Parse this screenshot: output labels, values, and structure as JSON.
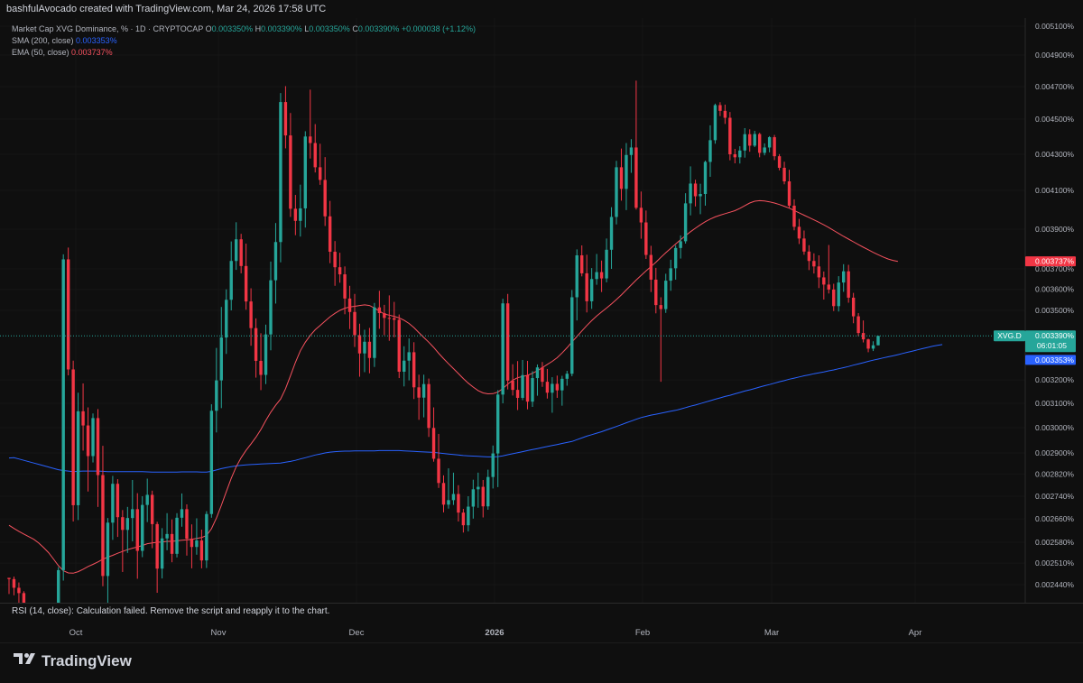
{
  "header": {
    "text": "bashfulAvocado created with TradingView.com, Mar 24, 2026 17:58 UTC"
  },
  "legend": {
    "title": "Market Cap XVG Dominance, % · 1D · CRYPTOCAP",
    "o_label": "O",
    "o_value": "0.003350%",
    "h_label": "H",
    "h_value": "0.003390%",
    "l_label": "L",
    "l_value": "0.003350%",
    "c_label": "C",
    "c_value": "0.003390%",
    "change": "+0.000038 (+1.12%)",
    "sma_label": "SMA (200, close)",
    "sma_value": "0.003353%",
    "ema_label": "EMA (50, close)",
    "ema_value": "0.003737%"
  },
  "rsi": {
    "text": "RSI (14, close): Calculation failed. Remove the script and reapply it to the chart."
  },
  "brand": {
    "name": "TradingView"
  },
  "colors": {
    "up": "#26a69a",
    "down": "#f23645",
    "sma": "#2962ff",
    "ema": "#f7525f",
    "background": "#0f0f0f"
  },
  "chart_data": {
    "type": "candlestick",
    "symbol": "XVG.D",
    "price_axis": {
      "ticks": [
        "0.005100%",
        "0.004900%",
        "0.004700%",
        "0.004500%",
        "0.004300%",
        "0.004100%",
        "0.003900%",
        "0.003700%",
        "0.003600%",
        "0.003500%",
        "0.003200%",
        "0.003100%",
        "0.003000%",
        "0.002900%",
        "0.002820%",
        "0.002740%",
        "0.002660%",
        "0.002580%",
        "0.002510%",
        "0.002440%"
      ],
      "scale": "log"
    },
    "time_axis": {
      "ticks": [
        "Oct",
        "Nov",
        "Dec",
        "2026",
        "Feb",
        "Mar",
        "Apr"
      ]
    },
    "labels": {
      "ema_price": "0.003737%",
      "last_symbol": "XVG.D",
      "last_price": "0.003390%",
      "countdown": "06:01:05",
      "sma_price": "0.003353%"
    },
    "candles": [
      [
        2.462,
        2.462,
        2.41,
        2.458
      ],
      [
        2.458,
        2.466,
        2.406,
        2.43
      ],
      [
        2.43,
        2.447,
        2.357,
        2.413
      ],
      [
        2.413,
        2.419,
        2.213,
        2.327
      ],
      [
        2.327,
        2.359,
        2.178,
        2.231
      ],
      [
        2.231,
        2.343,
        2.213,
        2.311
      ],
      [
        2.311,
        2.33,
        2.243,
        2.309
      ],
      [
        2.309,
        2.376,
        2.278,
        2.319
      ],
      [
        2.319,
        2.365,
        2.263,
        2.291
      ],
      [
        2.291,
        2.324,
        2.248,
        2.264
      ],
      [
        2.264,
        2.497,
        2.245,
        2.487
      ],
      [
        2.487,
        3.772,
        2.453,
        3.747
      ],
      [
        3.747,
        3.806,
        3.22,
        3.246
      ],
      [
        3.246,
        3.285,
        2.651,
        2.708
      ],
      [
        2.708,
        3.145,
        2.656,
        3.067
      ],
      [
        3.067,
        3.185,
        2.909,
        3.009
      ],
      [
        3.009,
        3.083,
        2.757,
        2.888
      ],
      [
        2.888,
        3.058,
        2.864,
        3.039
      ],
      [
        3.039,
        3.076,
        2.702,
        2.817
      ],
      [
        2.817,
        2.928,
        2.435,
        2.468
      ],
      [
        2.468,
        2.663,
        2.375,
        2.647
      ],
      [
        2.647,
        2.814,
        2.588,
        2.785
      ],
      [
        2.785,
        2.802,
        2.598,
        2.666
      ],
      [
        2.666,
        2.691,
        2.481,
        2.622
      ],
      [
        2.622,
        2.702,
        2.544,
        2.663
      ],
      [
        2.663,
        2.799,
        2.583,
        2.694
      ],
      [
        2.694,
        2.751,
        2.459,
        2.551
      ],
      [
        2.551,
        2.74,
        2.53,
        2.709
      ],
      [
        2.709,
        2.804,
        2.649,
        2.745
      ],
      [
        2.745,
        2.76,
        2.56,
        2.642
      ],
      [
        2.642,
        2.65,
        2.414,
        2.492
      ],
      [
        2.492,
        2.628,
        2.46,
        2.593
      ],
      [
        2.593,
        2.68,
        2.553,
        2.608
      ],
      [
        2.608,
        2.658,
        2.513,
        2.541
      ],
      [
        2.541,
        2.68,
        2.529,
        2.664
      ],
      [
        2.664,
        2.75,
        2.633,
        2.694
      ],
      [
        2.694,
        2.711,
        2.535,
        2.592
      ],
      [
        2.592,
        2.641,
        2.493,
        2.564
      ],
      [
        2.564,
        2.662,
        2.538,
        2.586
      ],
      [
        2.586,
        2.623,
        2.493,
        2.519
      ],
      [
        2.519,
        2.687,
        2.494,
        2.677
      ],
      [
        2.677,
        3.096,
        2.664,
        3.069
      ],
      [
        3.069,
        3.339,
        2.981,
        3.198
      ],
      [
        3.198,
        3.516,
        3.08,
        3.383
      ],
      [
        3.383,
        3.6,
        3.314,
        3.55
      ],
      [
        3.55,
        3.837,
        3.5,
        3.739
      ],
      [
        3.739,
        3.935,
        3.695,
        3.848
      ],
      [
        3.848,
        3.876,
        3.678,
        3.714
      ],
      [
        3.714,
        3.826,
        3.503,
        3.542
      ],
      [
        3.542,
        3.605,
        3.348,
        3.423
      ],
      [
        3.423,
        3.465,
        3.21,
        3.284
      ],
      [
        3.284,
        3.401,
        3.156,
        3.222
      ],
      [
        3.222,
        3.438,
        3.182,
        3.396
      ],
      [
        3.396,
        3.736,
        3.329,
        3.644
      ],
      [
        3.644,
        3.931,
        3.532,
        3.834
      ],
      [
        3.834,
        4.66,
        3.732,
        4.604
      ],
      [
        4.604,
        4.703,
        4.333,
        4.406
      ],
      [
        4.406,
        4.537,
        3.962,
        4.004
      ],
      [
        4.004,
        4.076,
        3.869,
        3.942
      ],
      [
        3.942,
        4.131,
        3.862,
        4.006
      ],
      [
        4.006,
        4.43,
        3.908,
        4.4
      ],
      [
        4.4,
        4.681,
        4.276,
        4.363
      ],
      [
        4.363,
        4.471,
        4.198,
        4.227
      ],
      [
        4.227,
        4.359,
        4.13,
        4.157
      ],
      [
        4.157,
        4.284,
        3.916,
        3.965
      ],
      [
        3.965,
        4.045,
        3.728,
        3.785
      ],
      [
        3.785,
        3.839,
        3.617,
        3.708
      ],
      [
        3.708,
        3.78,
        3.632,
        3.673
      ],
      [
        3.673,
        3.712,
        3.483,
        3.556
      ],
      [
        3.556,
        3.617,
        3.419,
        3.493
      ],
      [
        3.493,
        3.578,
        3.343,
        3.393
      ],
      [
        3.393,
        3.442,
        3.214,
        3.316
      ],
      [
        3.316,
        3.416,
        3.234,
        3.365
      ],
      [
        3.365,
        3.424,
        3.229,
        3.297
      ],
      [
        3.297,
        3.535,
        3.257,
        3.514
      ],
      [
        3.514,
        3.593,
        3.42,
        3.488
      ],
      [
        3.488,
        3.526,
        3.393,
        3.467
      ],
      [
        3.467,
        3.571,
        3.369,
        3.466
      ],
      [
        3.466,
        3.54,
        3.384,
        3.459
      ],
      [
        3.459,
        3.482,
        3.208,
        3.236
      ],
      [
        3.236,
        3.346,
        3.172,
        3.285
      ],
      [
        3.285,
        3.379,
        3.198,
        3.321
      ],
      [
        3.321,
        3.363,
        3.118,
        3.168
      ],
      [
        3.168,
        3.223,
        3.032,
        3.124
      ],
      [
        3.124,
        3.223,
        3.042,
        3.182
      ],
      [
        3.182,
        3.206,
        2.963,
        2.999
      ],
      [
        2.999,
        3.083,
        2.867,
        2.878
      ],
      [
        2.878,
        2.975,
        2.77,
        2.788
      ],
      [
        2.788,
        2.816,
        2.683,
        2.71
      ],
      [
        2.71,
        2.842,
        2.696,
        2.726
      ],
      [
        2.726,
        2.826,
        2.709,
        2.748
      ],
      [
        2.748,
        2.78,
        2.651,
        2.682
      ],
      [
        2.682,
        2.695,
        2.613,
        2.638
      ],
      [
        2.638,
        2.74,
        2.617,
        2.703
      ],
      [
        2.703,
        2.8,
        2.661,
        2.765
      ],
      [
        2.765,
        2.826,
        2.699,
        2.774
      ],
      [
        2.774,
        2.799,
        2.665,
        2.704
      ],
      [
        2.704,
        2.837,
        2.692,
        2.81
      ],
      [
        2.81,
        2.929,
        2.768,
        2.898
      ],
      [
        2.898,
        3.156,
        2.773,
        3.137
      ],
      [
        3.137,
        3.555,
        3.1,
        3.533
      ],
      [
        3.533,
        3.578,
        3.159,
        3.197
      ],
      [
        3.197,
        3.269,
        3.133,
        3.157
      ],
      [
        3.157,
        3.283,
        3.072,
        3.123
      ],
      [
        3.123,
        3.288,
        3.113,
        3.221
      ],
      [
        3.221,
        3.284,
        3.075,
        3.107
      ],
      [
        3.107,
        3.238,
        3.085,
        3.208
      ],
      [
        3.208,
        3.268,
        3.132,
        3.255
      ],
      [
        3.255,
        3.279,
        3.17,
        3.192
      ],
      [
        3.192,
        3.248,
        3.12,
        3.145
      ],
      [
        3.145,
        3.212,
        3.061,
        3.183
      ],
      [
        3.183,
        3.219,
        3.123,
        3.155
      ],
      [
        3.155,
        3.218,
        3.09,
        3.205
      ],
      [
        3.205,
        3.24,
        3.175,
        3.227
      ],
      [
        3.227,
        3.597,
        3.216,
        3.562
      ],
      [
        3.562,
        3.797,
        3.456,
        3.767
      ],
      [
        3.767,
        3.817,
        3.663,
        3.678
      ],
      [
        3.678,
        3.77,
        3.491,
        3.543
      ],
      [
        3.543,
        3.704,
        3.507,
        3.65
      ],
      [
        3.65,
        3.774,
        3.622,
        3.684
      ],
      [
        3.684,
        3.741,
        3.587,
        3.653
      ],
      [
        3.653,
        3.852,
        3.634,
        3.795
      ],
      [
        3.795,
        4.012,
        3.7,
        3.962
      ],
      [
        3.962,
        4.263,
        3.924,
        4.227
      ],
      [
        4.227,
        4.332,
        4.046,
        4.108
      ],
      [
        4.108,
        4.363,
        3.997,
        4.296
      ],
      [
        4.296,
        4.385,
        4.196,
        4.338
      ],
      [
        4.338,
        4.737,
        4.0,
        4.009
      ],
      [
        4.009,
        4.094,
        3.851,
        3.934
      ],
      [
        3.934,
        3.995,
        3.749,
        3.769
      ],
      [
        3.769,
        3.815,
        3.587,
        3.647
      ],
      [
        3.647,
        3.705,
        3.487,
        3.525
      ],
      [
        3.525,
        3.562,
        3.192,
        3.506
      ],
      [
        3.506,
        3.676,
        3.489,
        3.642
      ],
      [
        3.642,
        3.745,
        3.593,
        3.703
      ],
      [
        3.703,
        3.818,
        3.647,
        3.804
      ],
      [
        3.804,
        3.868,
        3.751,
        3.838
      ],
      [
        3.838,
        4.085,
        3.826,
        4.032
      ],
      [
        4.032,
        4.232,
        3.97,
        4.137
      ],
      [
        4.137,
        4.158,
        4.016,
        4.069
      ],
      [
        4.069,
        4.136,
        3.976,
        4.081
      ],
      [
        4.081,
        4.264,
        4.02,
        4.257
      ],
      [
        4.257,
        4.464,
        4.174,
        4.379
      ],
      [
        4.379,
        4.594,
        4.359,
        4.585
      ],
      [
        4.585,
        4.603,
        4.518,
        4.55
      ],
      [
        4.55,
        4.588,
        4.472,
        4.508
      ],
      [
        4.508,
        4.543,
        4.266,
        4.3
      ],
      [
        4.3,
        4.33,
        4.249,
        4.283
      ],
      [
        4.283,
        4.345,
        4.248,
        4.321
      ],
      [
        4.321,
        4.448,
        4.281,
        4.413
      ],
      [
        4.413,
        4.441,
        4.314,
        4.348
      ],
      [
        4.348,
        4.432,
        4.34,
        4.414
      ],
      [
        4.414,
        4.421,
        4.283,
        4.308
      ],
      [
        4.308,
        4.361,
        4.294,
        4.338
      ],
      [
        4.338,
        4.402,
        4.311,
        4.396
      ],
      [
        4.396,
        4.409,
        4.267,
        4.289
      ],
      [
        4.289,
        4.301,
        4.21,
        4.224
      ],
      [
        4.224,
        4.258,
        4.133,
        4.149
      ],
      [
        4.149,
        4.213,
        4.008,
        4.02
      ],
      [
        4.02,
        4.053,
        3.894,
        3.912
      ],
      [
        3.912,
        3.952,
        3.824,
        3.852
      ],
      [
        3.852,
        3.893,
        3.77,
        3.786
      ],
      [
        3.786,
        3.818,
        3.694,
        3.739
      ],
      [
        3.739,
        3.777,
        3.677,
        3.712
      ],
      [
        3.712,
        3.767,
        3.606,
        3.658
      ],
      [
        3.658,
        3.687,
        3.551,
        3.623
      ],
      [
        3.623,
        3.819,
        3.58,
        3.599
      ],
      [
        3.599,
        3.627,
        3.497,
        3.52
      ],
      [
        3.52,
        3.664,
        3.495,
        3.633
      ],
      [
        3.633,
        3.723,
        3.588,
        3.688
      ],
      [
        3.688,
        3.72,
        3.536,
        3.56
      ],
      [
        3.56,
        3.583,
        3.444,
        3.474
      ],
      [
        3.474,
        3.488,
        3.388,
        3.402
      ],
      [
        3.402,
        3.456,
        3.362,
        3.375
      ],
      [
        3.375,
        3.378,
        3.321,
        3.336
      ],
      [
        3.336,
        3.367,
        3.326,
        3.35
      ],
      [
        3.35,
        3.39,
        3.35,
        3.39
      ]
    ],
    "sma_200": [
      2.881,
      2.882,
      2.877,
      2.872,
      2.867,
      2.862,
      2.857,
      2.852,
      2.847,
      2.842,
      2.837,
      2.834,
      2.832,
      2.83,
      2.831,
      2.832,
      2.832,
      2.832,
      2.832,
      2.831,
      2.83,
      2.83,
      2.83,
      2.83,
      2.83,
      2.83,
      2.83,
      2.83,
      2.829,
      2.828,
      2.828,
      2.828,
      2.828,
      2.828,
      2.828,
      2.829,
      2.829,
      2.829,
      2.829,
      2.828,
      2.828,
      2.831,
      2.836,
      2.841,
      2.845,
      2.848,
      2.851,
      2.853,
      2.855,
      2.856,
      2.857,
      2.858,
      2.859,
      2.86,
      2.861,
      2.862,
      2.865,
      2.868,
      2.872,
      2.877,
      2.882,
      2.887,
      2.892,
      2.896,
      2.9,
      2.903,
      2.905,
      2.906,
      2.907,
      2.907,
      2.908,
      2.908,
      2.908,
      2.908,
      2.908,
      2.909,
      2.909,
      2.909,
      2.909,
      2.909,
      2.908,
      2.907,
      2.906,
      2.905,
      2.904,
      2.903,
      2.902,
      2.9,
      2.898,
      2.896,
      2.894,
      2.892,
      2.89,
      2.889,
      2.888,
      2.887,
      2.886,
      2.885,
      2.885,
      2.886,
      2.889,
      2.893,
      2.897,
      2.901,
      2.905,
      2.909,
      2.913,
      2.917,
      2.921,
      2.925,
      2.929,
      2.933,
      2.937,
      2.941,
      2.945,
      2.952,
      2.959,
      2.966,
      2.972,
      2.978,
      2.984,
      2.991,
      2.998,
      3.005,
      3.012,
      3.02,
      3.027,
      3.034,
      3.041,
      3.046,
      3.051,
      3.055,
      3.059,
      3.063,
      3.067,
      3.071,
      3.076,
      3.082,
      3.088,
      3.093,
      3.099,
      3.105,
      3.111,
      3.117,
      3.123,
      3.129,
      3.134,
      3.14,
      3.146,
      3.152,
      3.157,
      3.163,
      3.169,
      3.175,
      3.18,
      3.186,
      3.192,
      3.197,
      3.203,
      3.208,
      3.213,
      3.218,
      3.222,
      3.227,
      3.231,
      3.235,
      3.24,
      3.244,
      3.249,
      3.254,
      3.259,
      3.265,
      3.27,
      3.276,
      3.282,
      3.287,
      3.292,
      3.297,
      3.302,
      3.306,
      3.311,
      3.316,
      3.321,
      3.326,
      3.331,
      3.336,
      3.341,
      3.346,
      3.35,
      3.353
    ],
    "ema_50": [
      2.638,
      2.627,
      2.617,
      2.608,
      2.599,
      2.59,
      2.578,
      2.562,
      2.545,
      2.524,
      2.502,
      2.485,
      2.478,
      2.477,
      2.482,
      2.49,
      2.499,
      2.506,
      2.514,
      2.523,
      2.53,
      2.536,
      2.543,
      2.549,
      2.555,
      2.56,
      2.564,
      2.569,
      2.575,
      2.578,
      2.58,
      2.581,
      2.583,
      2.583,
      2.585,
      2.587,
      2.588,
      2.59,
      2.593,
      2.596,
      2.603,
      2.626,
      2.663,
      2.708,
      2.757,
      2.805,
      2.848,
      2.882,
      2.91,
      2.935,
      2.962,
      2.993,
      3.029,
      3.063,
      3.092,
      3.118,
      3.162,
      3.219,
      3.278,
      3.327,
      3.363,
      3.392,
      3.416,
      3.434,
      3.453,
      3.472,
      3.487,
      3.5,
      3.51,
      3.516,
      3.519,
      3.523,
      3.526,
      3.523,
      3.511,
      3.497,
      3.484,
      3.479,
      3.474,
      3.467,
      3.457,
      3.443,
      3.425,
      3.404,
      3.383,
      3.363,
      3.341,
      3.317,
      3.294,
      3.271,
      3.25,
      3.228,
      3.206,
      3.186,
      3.169,
      3.154,
      3.144,
      3.14,
      3.141,
      3.148,
      3.163,
      3.182,
      3.199,
      3.21,
      3.215,
      3.22,
      3.229,
      3.24,
      3.254,
      3.268,
      3.282,
      3.298,
      3.318,
      3.34,
      3.364,
      3.387,
      3.411,
      3.434,
      3.455,
      3.475,
      3.493,
      3.511,
      3.53,
      3.551,
      3.573,
      3.597,
      3.621,
      3.645,
      3.668,
      3.69,
      3.711,
      3.733,
      3.757,
      3.78,
      3.802,
      3.824,
      3.846,
      3.867,
      3.887,
      3.905,
      3.922,
      3.938,
      3.951,
      3.962,
      3.971,
      3.979,
      3.986,
      3.994,
      4.006,
      4.02,
      4.034,
      4.043,
      4.046,
      4.044,
      4.04,
      4.034,
      4.026,
      4.017,
      4.007,
      3.995,
      3.983,
      3.971,
      3.959,
      3.947,
      3.935,
      3.922,
      3.908,
      3.893,
      3.878,
      3.863,
      3.849,
      3.835,
      3.821,
      3.808,
      3.795,
      3.782,
      3.77,
      3.759,
      3.749,
      3.742,
      3.737
    ]
  }
}
